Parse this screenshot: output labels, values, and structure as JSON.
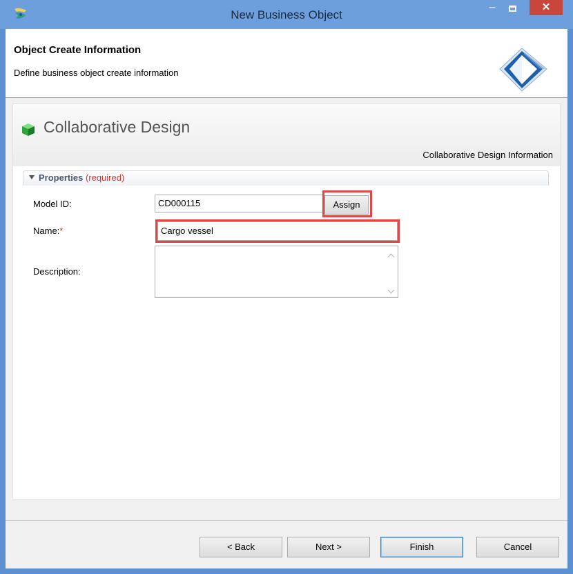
{
  "window": {
    "title": "New Business Object",
    "minimize_glyph": "–",
    "close_glyph": "✕"
  },
  "header": {
    "title": "Object Create Information",
    "description": "Define business object create information"
  },
  "form": {
    "title": "Collaborative Design",
    "subtitle": "Collaborative Design Information",
    "section": {
      "title": "Properties",
      "required": "(required)"
    },
    "fields": {
      "model_id": {
        "label": "Model ID:",
        "value": "CD000115"
      },
      "name": {
        "label": "Name:",
        "required_mark": "*",
        "value": "Cargo vessel"
      },
      "description": {
        "label": "Description:",
        "value": ""
      }
    },
    "assign_label": "Assign"
  },
  "footer": {
    "back_label": "< Back",
    "next_label": "Next >",
    "finish_label": "Finish",
    "cancel_label": "Cancel"
  },
  "icons": {
    "app": "eclipse-app-icon",
    "header": "wizard-banner-icon",
    "form": "green-cube-icon",
    "section": "triangle-down-icon"
  },
  "colors": {
    "titlebar": "#6c9fdc",
    "close_button": "#c9463d",
    "required_red": "#e03030",
    "highlight_red": "#e04848",
    "form_title_gray": "#555555"
  }
}
